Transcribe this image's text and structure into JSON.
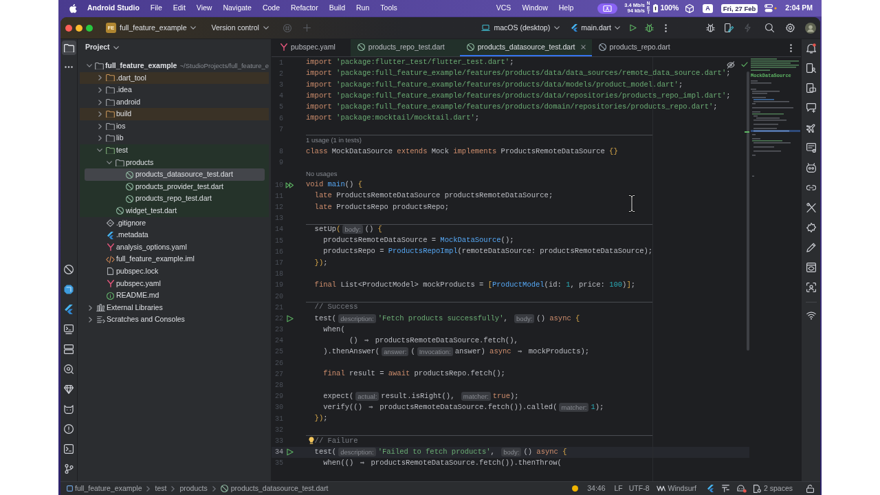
{
  "menu_bar": {
    "app_name": "Android Studio",
    "menus_left": [
      "File",
      "Edit",
      "View",
      "Navigate",
      "Code",
      "Refactor",
      "Build",
      "Run",
      "Tools"
    ],
    "menus_right": [
      "VCS",
      "Window",
      "Help"
    ],
    "network_up": "3.4 Mb/s",
    "network_down": "94 kb/s",
    "network_label": "NET",
    "battery": "100%",
    "input_source": "A",
    "date": "Fri, 27 Feb",
    "time": "2:04 PM"
  },
  "toolbar": {
    "project_initials": "FE",
    "project": "full_feature_example",
    "vcs": "Version control",
    "device": "macOS (desktop)",
    "run_config": "main.dart"
  },
  "tool_strip": {
    "project_active": true
  },
  "project_panel": {
    "title": "Project",
    "tree": [
      {
        "kind": "module",
        "label": "full_feature_example",
        "path": "~/StudioProjects/full_feature_e",
        "expanded": true,
        "selected": false,
        "children": [
          {
            "kind": "excluded_folder",
            "label": ".dart_tool",
            "expanded": false,
            "selected": false
          },
          {
            "kind": "folder",
            "label": ".idea",
            "expanded": false,
            "selected": false
          },
          {
            "kind": "folder",
            "label": "android",
            "expanded": false,
            "selected": false
          },
          {
            "kind": "excluded_folder",
            "label": "build",
            "expanded": false,
            "selected": false
          },
          {
            "kind": "folder",
            "label": "ios",
            "expanded": false,
            "selected": false
          },
          {
            "kind": "folder",
            "label": "lib",
            "expanded": false,
            "selected": false
          },
          {
            "kind": "test_folder",
            "label": "test",
            "expanded": true,
            "selected": false,
            "children": [
              {
                "kind": "folder",
                "label": "products",
                "expanded": true,
                "selected": false,
                "children": [
                  {
                    "kind": "dart_test",
                    "label": "products_datasource_test.dart",
                    "selected": true
                  },
                  {
                    "kind": "dart_test",
                    "label": "products_provider_test.dart",
                    "selected": false
                  },
                  {
                    "kind": "dart_test",
                    "label": "products_repo_test.dart",
                    "selected": false
                  }
                ]
              },
              {
                "kind": "dart_test",
                "label": "widget_test.dart",
                "selected": false
              }
            ]
          },
          {
            "kind": "gitignore",
            "label": ".gitignore",
            "selected": false
          },
          {
            "kind": "flutter",
            "label": ".metadata",
            "selected": false
          },
          {
            "kind": "yaml",
            "label": "analysis_options.yaml",
            "selected": false
          },
          {
            "kind": "iml",
            "label": "full_feature_example.iml",
            "selected": false
          },
          {
            "kind": "file",
            "label": "pubspec.lock",
            "selected": false
          },
          {
            "kind": "yaml",
            "label": "pubspec.yaml",
            "selected": false
          },
          {
            "kind": "readme",
            "label": "README.md",
            "selected": false
          }
        ]
      },
      {
        "kind": "library",
        "label": "External Libraries",
        "expanded": false,
        "selected": false
      },
      {
        "kind": "scratch",
        "label": "Scratches and Consoles",
        "expanded": false,
        "selected": false
      }
    ]
  },
  "editor": {
    "tabs": [
      {
        "kind": "yaml",
        "label": "pubspec.yaml",
        "selected": false,
        "test_scope": false
      },
      {
        "kind": "dart_test",
        "label": "products_repo_test.dart",
        "selected": false,
        "test_scope": true
      },
      {
        "kind": "dart_test",
        "label": "products_datasource_test.dart",
        "selected": true,
        "test_scope": true
      },
      {
        "kind": "dart",
        "label": "products_repo.dart",
        "selected": false,
        "test_scope": false
      }
    ],
    "lines": [
      {
        "kind": "code",
        "number": "1",
        "separator": false,
        "current": false,
        "tokens": [
          {
            "kind": "keyword",
            "text": "import"
          },
          {
            "kind": "string",
            "text": " 'package:flutter_test/flutter_test.dart'"
          },
          {
            "kind": "plain",
            "text": ";"
          }
        ]
      },
      {
        "kind": "code",
        "number": "2",
        "separator": false,
        "current": false,
        "tokens": [
          {
            "kind": "keyword",
            "text": "import"
          },
          {
            "kind": "string",
            "text": " 'package:full_feature_example/features/products/data/data_sources/remote_data_source.dart'"
          },
          {
            "kind": "plain",
            "text": ";"
          }
        ]
      },
      {
        "kind": "code",
        "number": "3",
        "separator": false,
        "current": false,
        "tokens": [
          {
            "kind": "keyword",
            "text": "import"
          },
          {
            "kind": "string",
            "text": " 'package:full_feature_example/features/products/data/models/product_model.dart'"
          },
          {
            "kind": "plain",
            "text": ";"
          }
        ]
      },
      {
        "kind": "code",
        "number": "4",
        "separator": false,
        "current": false,
        "tokens": [
          {
            "kind": "keyword",
            "text": "import"
          },
          {
            "kind": "string",
            "text": " 'package:full_feature_example/features/products/data/repositories/products_repo_impl.dart'"
          },
          {
            "kind": "plain",
            "text": ";"
          }
        ]
      },
      {
        "kind": "code",
        "number": "5",
        "separator": false,
        "current": false,
        "tokens": [
          {
            "kind": "keyword",
            "text": "import"
          },
          {
            "kind": "string",
            "text": " 'package:full_feature_example/features/products/domain/repositories/products_repo.dart'"
          },
          {
            "kind": "plain",
            "text": ";"
          }
        ]
      },
      {
        "kind": "code",
        "number": "6",
        "separator": false,
        "current": false,
        "tokens": [
          {
            "kind": "keyword",
            "text": "import"
          },
          {
            "kind": "string",
            "text": " 'package:mocktail/mocktail.dart'"
          },
          {
            "kind": "plain",
            "text": ";"
          }
        ]
      },
      {
        "kind": "code",
        "number": "7",
        "separator": false,
        "current": false
      },
      {
        "kind": "usages",
        "text": "1 usage (1 in tests)",
        "separator": true,
        "current": false
      },
      {
        "kind": "code",
        "number": "8",
        "separator": false,
        "current": false,
        "tokens": [
          {
            "kind": "keyword",
            "text": "class"
          },
          {
            "kind": "plain",
            "text": " MockDataSource "
          },
          {
            "kind": "keyword",
            "text": "extends"
          },
          {
            "kind": "plain",
            "text": " Mock "
          },
          {
            "kind": "keyword",
            "text": "implements"
          },
          {
            "kind": "plain",
            "text": " ProductsRemoteDataSource "
          },
          {
            "kind": "brace",
            "text": "{}"
          }
        ]
      },
      {
        "kind": "code",
        "number": "9",
        "separator": false,
        "current": false
      },
      {
        "kind": "usages",
        "text": "No usages",
        "separator": false,
        "current": false
      },
      {
        "kind": "code",
        "number": "10",
        "separator": false,
        "current": false,
        "marker": {
          "kind": "run_all"
        },
        "tokens": [
          {
            "kind": "keyword",
            "text": "void"
          },
          {
            "kind": "call",
            "text": " main"
          },
          {
            "kind": "plain",
            "text": "() "
          },
          {
            "kind": "brace",
            "text": "{"
          }
        ]
      },
      {
        "kind": "code",
        "number": "11",
        "separator": false,
        "current": false,
        "tokens": [
          {
            "kind": "keyword",
            "text": "  late"
          },
          {
            "kind": "plain",
            "text": " ProductsRemoteDataSource productsRemoteDataSource;"
          }
        ]
      },
      {
        "kind": "code",
        "number": "12",
        "separator": false,
        "current": false,
        "tokens": [
          {
            "kind": "keyword",
            "text": "  late"
          },
          {
            "kind": "plain",
            "text": " ProductsRepo productsRepo;"
          }
        ]
      },
      {
        "kind": "code",
        "number": "13",
        "separator": false,
        "current": false
      },
      {
        "kind": "code",
        "number": "14",
        "separator": true,
        "current": false,
        "tokens": [
          {
            "kind": "plain",
            "text": "  setUp"
          },
          {
            "kind": "brace",
            "text": "("
          },
          {
            "kind": "hint",
            "text": "body:"
          },
          {
            "kind": "plain",
            "text": "() "
          },
          {
            "kind": "brace",
            "text": "{"
          }
        ]
      },
      {
        "kind": "code",
        "number": "15",
        "separator": false,
        "current": false,
        "tokens": [
          {
            "kind": "plain",
            "text": "    productsRemoteDataSource = "
          },
          {
            "kind": "call",
            "text": "MockDataSource"
          },
          {
            "kind": "plain",
            "text": "();"
          }
        ]
      },
      {
        "kind": "code",
        "number": "16",
        "separator": false,
        "current": false,
        "tokens": [
          {
            "kind": "plain",
            "text": "    productsRepo = "
          },
          {
            "kind": "call",
            "text": "ProductsRepoImpl"
          },
          {
            "kind": "plain",
            "text": "(remoteDataSource: productsRemoteDataSource);"
          }
        ]
      },
      {
        "kind": "code",
        "number": "17",
        "separator": false,
        "current": false,
        "tokens": [
          {
            "kind": "brace",
            "text": "  })"
          },
          {
            "kind": "plain",
            "text": ";"
          }
        ]
      },
      {
        "kind": "code",
        "number": "18",
        "separator": false,
        "current": false
      },
      {
        "kind": "code",
        "number": "19",
        "separator": false,
        "current": false,
        "tokens": [
          {
            "kind": "keyword",
            "text": "  final"
          },
          {
            "kind": "plain",
            "text": " List<ProductModel> mockProducts = "
          },
          {
            "kind": "brace",
            "text": "["
          },
          {
            "kind": "call",
            "text": "ProductModel"
          },
          {
            "kind": "plain",
            "text": "(id: "
          },
          {
            "kind": "number",
            "text": "1"
          },
          {
            "kind": "plain",
            "text": ", price: "
          },
          {
            "kind": "number",
            "text": "100"
          },
          {
            "kind": "plain",
            "text": ")"
          },
          {
            "kind": "brace",
            "text": "]"
          },
          {
            "kind": "plain",
            "text": ";"
          }
        ]
      },
      {
        "kind": "code",
        "number": "20",
        "separator": false,
        "current": false
      },
      {
        "kind": "code",
        "number": "21",
        "separator": true,
        "current": false,
        "tokens": [
          {
            "kind": "comment",
            "text": "  // Success"
          }
        ]
      },
      {
        "kind": "code",
        "number": "22",
        "separator": false,
        "current": false,
        "marker": {
          "kind": "run"
        },
        "tokens": [
          {
            "kind": "plain",
            "text": "  test("
          },
          {
            "kind": "hint",
            "text": "description:"
          },
          {
            "kind": "string",
            "text": "'Fetch products successfully'"
          },
          {
            "kind": "plain",
            "text": ", "
          },
          {
            "kind": "hint",
            "text": "body:"
          },
          {
            "kind": "plain",
            "text": "() "
          },
          {
            "kind": "keyword",
            "text": "async"
          },
          {
            "kind": "brace",
            "text": " {"
          }
        ]
      },
      {
        "kind": "code",
        "number": "23",
        "separator": false,
        "current": false,
        "tokens": [
          {
            "kind": "plain",
            "text": "    when("
          }
        ]
      },
      {
        "kind": "code",
        "number": "24",
        "separator": false,
        "current": false,
        "tokens": [
          {
            "kind": "plain",
            "text": "          () "
          },
          {
            "kind": "arrow",
            "text": "⇒"
          },
          {
            "kind": "plain",
            "text": " productsRemoteDataSource.fetch(),"
          }
        ]
      },
      {
        "kind": "code",
        "number": "25",
        "separator": false,
        "current": false,
        "tokens": [
          {
            "kind": "plain",
            "text": "    ).thenAnswer("
          },
          {
            "kind": "hint",
            "text": "answer:"
          },
          {
            "kind": "plain",
            "text": "("
          },
          {
            "kind": "hint",
            "text": "Invocation:"
          },
          {
            "kind": "plain",
            "text": "answer) "
          },
          {
            "kind": "keyword",
            "text": "async"
          },
          {
            "kind": "arrow",
            "text": " ⇒"
          },
          {
            "kind": "plain",
            "text": " mockProducts);"
          }
        ]
      },
      {
        "kind": "code",
        "number": "26",
        "separator": false,
        "current": false
      },
      {
        "kind": "code",
        "number": "27",
        "separator": false,
        "current": false,
        "tokens": [
          {
            "kind": "keyword",
            "text": "    final"
          },
          {
            "kind": "plain",
            "text": " result = "
          },
          {
            "kind": "keyword",
            "text": "await"
          },
          {
            "kind": "plain",
            "text": " productsRepo.fetch();"
          }
        ]
      },
      {
        "kind": "code",
        "number": "28",
        "separator": false,
        "current": false
      },
      {
        "kind": "code",
        "number": "29",
        "separator": false,
        "current": false,
        "tokens": [
          {
            "kind": "plain",
            "text": "    expect("
          },
          {
            "kind": "hint",
            "text": "actual:"
          },
          {
            "kind": "plain",
            "text": "result.isRight(), "
          },
          {
            "kind": "hint",
            "text": "matcher:"
          },
          {
            "kind": "keyword",
            "text": "true"
          },
          {
            "kind": "plain",
            "text": ");"
          }
        ]
      },
      {
        "kind": "code",
        "number": "30",
        "separator": false,
        "current": false,
        "tokens": [
          {
            "kind": "plain",
            "text": "    verify(() "
          },
          {
            "kind": "arrow",
            "text": "⇒"
          },
          {
            "kind": "plain",
            "text": " productsRemoteDataSource.fetch()).called("
          },
          {
            "kind": "hint",
            "text": "matcher:"
          },
          {
            "kind": "number",
            "text": "1"
          },
          {
            "kind": "plain",
            "text": ");"
          }
        ]
      },
      {
        "kind": "code",
        "number": "31",
        "separator": false,
        "current": false,
        "tokens": [
          {
            "kind": "brace",
            "text": "  })"
          },
          {
            "kind": "plain",
            "text": ";"
          }
        ]
      },
      {
        "kind": "code",
        "number": "32",
        "separator": false,
        "current": false
      },
      {
        "kind": "code",
        "number": "33",
        "separator": true,
        "current": false,
        "marker": {
          "kind": "intention"
        },
        "tokens": [
          {
            "kind": "comment",
            "text": "  // Failure"
          }
        ]
      },
      {
        "kind": "code",
        "number": "34",
        "separator": false,
        "current": true,
        "marker": {
          "kind": "run"
        },
        "tokens": [
          {
            "kind": "plain",
            "text": "  test("
          },
          {
            "kind": "hint",
            "text": "description:"
          },
          {
            "kind": "string",
            "text": "'Failed to fetch products'"
          },
          {
            "kind": "plain",
            "text": ", "
          },
          {
            "kind": "hint",
            "text": "body:"
          },
          {
            "kind": "plain",
            "text": "() "
          },
          {
            "kind": "keyword",
            "text": "async"
          },
          {
            "kind": "brace",
            "text": " {"
          }
        ]
      },
      {
        "kind": "code",
        "number": "35",
        "separator": false,
        "current": false,
        "tokens": [
          {
            "kind": "plain",
            "text": "    when(() "
          },
          {
            "kind": "arrow",
            "text": "⇒"
          },
          {
            "kind": "plain",
            "text": " productsRemoteDataSource.fetch()).thenThrow("
          }
        ]
      }
    ],
    "minimap": {
      "heading": "MockDataSource"
    }
  },
  "status_bar": {
    "breadcrumbs": [
      {
        "kind": "module",
        "label": "full_feature_example"
      },
      {
        "kind": "folder",
        "label": "test"
      },
      {
        "kind": "folder",
        "label": "products"
      },
      {
        "kind": "dart_test",
        "label": "products_datasource_test.dart"
      }
    ],
    "position": "34:46",
    "line_separator": "LF",
    "encoding": "UTF-8",
    "plugin": "Windsurf",
    "indent": "2 spaces"
  }
}
